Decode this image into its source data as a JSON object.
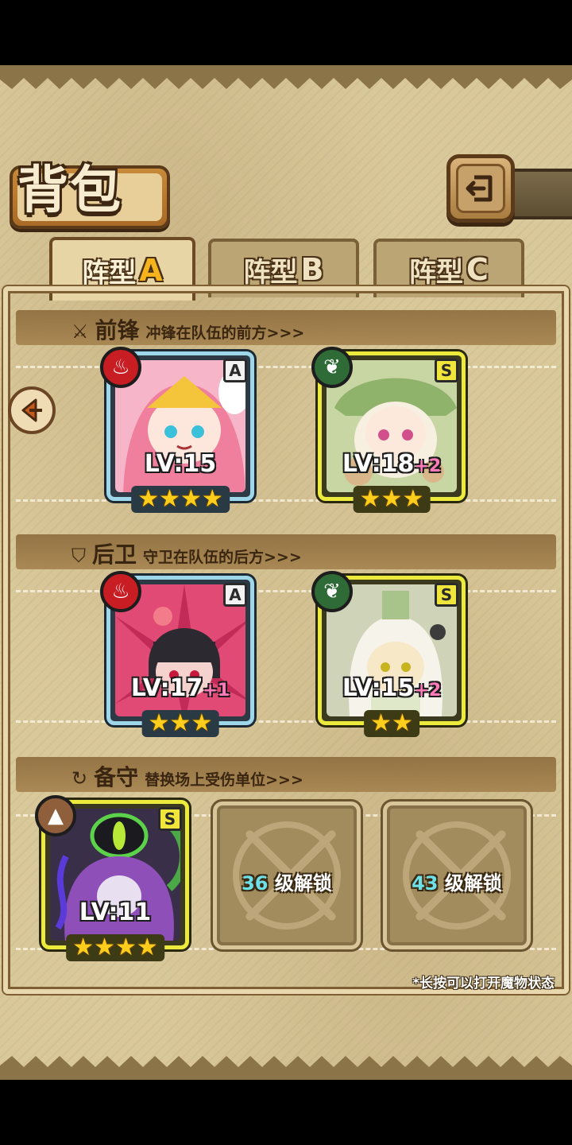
{
  "header": {
    "title": "背包",
    "back_icon": "back-arrow-icon"
  },
  "tabs": [
    {
      "label": "阵型",
      "letter": "A",
      "active": true
    },
    {
      "label": "阵型",
      "letter": "B",
      "active": false
    },
    {
      "label": "阵型",
      "letter": "C",
      "active": false
    }
  ],
  "sections": {
    "front": {
      "name": "前锋",
      "desc": "冲锋在队伍的前方>>>",
      "icon": "sword-icon"
    },
    "back": {
      "name": "后卫",
      "desc": "守卫在队伍的后方>>>",
      "icon": "shield-icon"
    },
    "reserve": {
      "name": "备守",
      "desc": "替换场上受伤单位>>>",
      "icon": "swap-icon"
    }
  },
  "units": {
    "front_1": {
      "level": "LV:15",
      "bonus": "",
      "rank": "A",
      "element": "fire",
      "stars": 4
    },
    "front_2": {
      "level": "LV:18",
      "bonus": "+2",
      "rank": "S",
      "element": "leaf",
      "stars": 3
    },
    "back_1": {
      "level": "LV:17",
      "bonus": "+1",
      "rank": "A",
      "element": "fire",
      "stars": 3
    },
    "back_2": {
      "level": "LV:15",
      "bonus": "+2",
      "rank": "S",
      "element": "leaf",
      "stars": 2
    },
    "reserve_1": {
      "level": "LV:11",
      "bonus": "",
      "rank": "S",
      "element": "rock",
      "stars": 4
    }
  },
  "locked_slots": [
    {
      "level": "36",
      "text": "级解锁"
    },
    {
      "level": "43",
      "text": "级解锁"
    }
  ],
  "footnote": "*长按可以打开魔物状态",
  "colors": {
    "rank_a_border": "#9fd7ea",
    "rank_s_border": "#ecea3c",
    "accent_tab": "#f6b31c"
  }
}
